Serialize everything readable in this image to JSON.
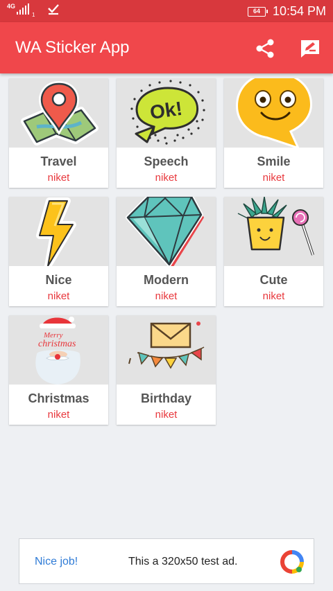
{
  "status_bar": {
    "network": "4G",
    "sim_slot": "1",
    "battery": "64",
    "time": "10:54 PM"
  },
  "app_bar": {
    "title": "WA Sticker App",
    "actions": [
      "share-icon",
      "feedback-icon"
    ]
  },
  "sticker_packs": [
    {
      "name": "Travel",
      "author": "niket",
      "icon": "map-pin-icon"
    },
    {
      "name": "Speech",
      "author": "niket",
      "icon": "ok-speech-bubble-icon"
    },
    {
      "name": "Smile",
      "author": "niket",
      "icon": "smiley-bubble-icon"
    },
    {
      "name": "Nice",
      "author": "niket",
      "icon": "lightning-icon"
    },
    {
      "name": "Modern",
      "author": "niket",
      "icon": "diamond-icon"
    },
    {
      "name": "Cute",
      "author": "niket",
      "icon": "cactus-pot-icon"
    },
    {
      "name": "Christmas",
      "author": "niket",
      "icon": "santa-icon"
    },
    {
      "name": "Birthday",
      "author": "niket",
      "icon": "envelope-bunting-icon"
    }
  ],
  "ad_banner": {
    "cta": "Nice job!",
    "message": "This a 320x50 test ad.",
    "icon": "ad-logo-icon"
  },
  "colors": {
    "status_bar": "#d8383d",
    "app_bar": "#f0474b",
    "author_text": "#e8383d",
    "background": "#eef0f3"
  }
}
